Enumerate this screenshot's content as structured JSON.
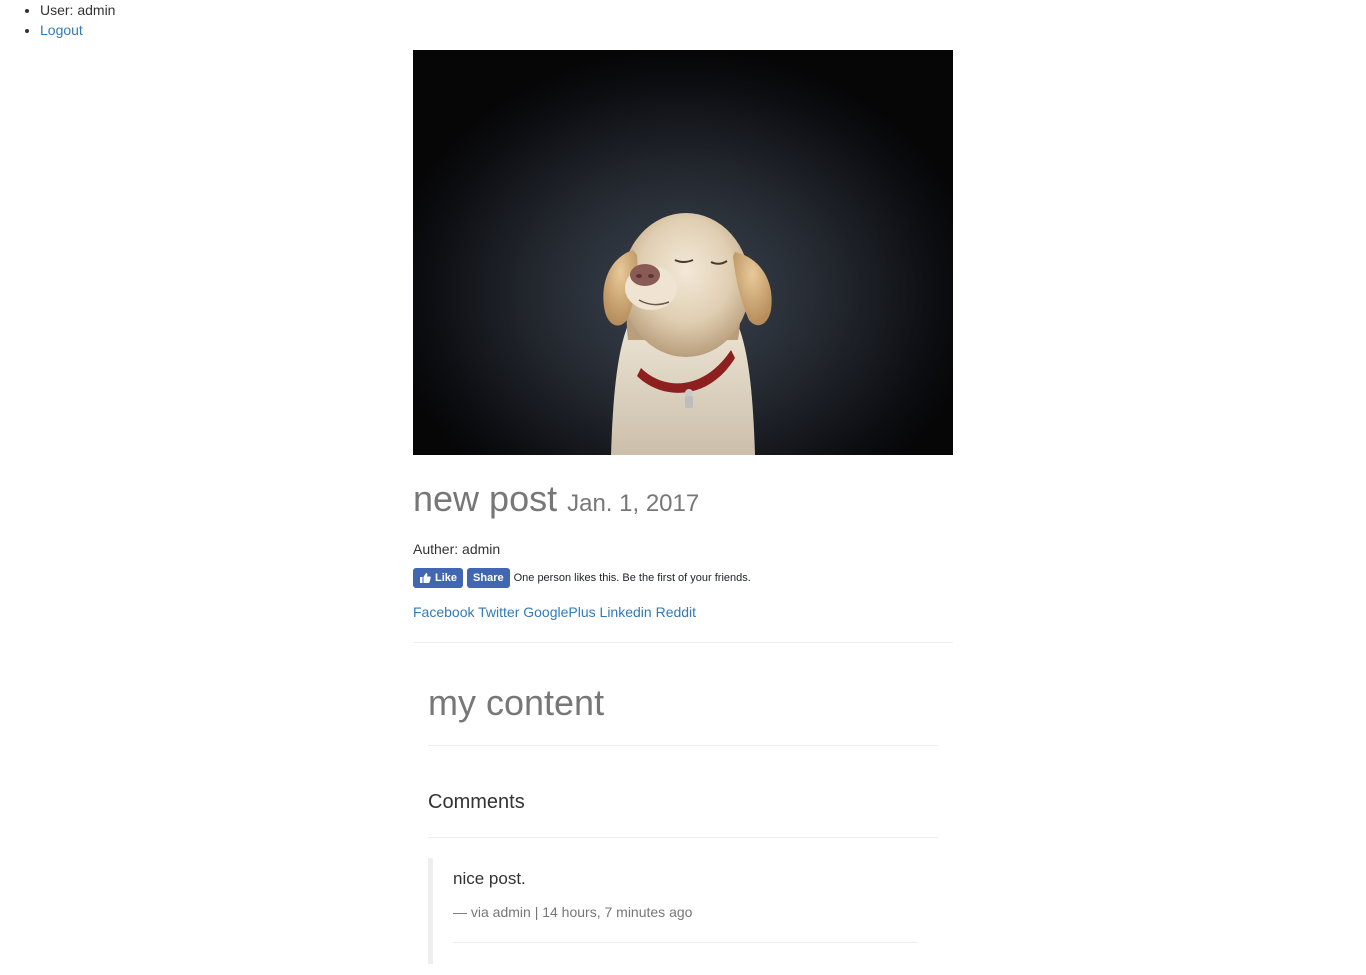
{
  "nav": {
    "user_label": "User: admin",
    "logout_label": "Logout"
  },
  "post": {
    "title": "new post",
    "date": "Jan. 1, 2017",
    "author": "Auther: admin",
    "fb": {
      "like_label": "Like",
      "share_label": "Share",
      "like_text": "One person likes this. Be the first of your friends."
    },
    "share_links": [
      "Facebook",
      "Twitter",
      "GooglePlus",
      "Linkedin",
      "Reddit"
    ],
    "content": "my content"
  },
  "comments": {
    "heading": "Comments",
    "items": [
      {
        "text": "nice post.",
        "meta": "— via admin | 14 hours, 7 minutes ago"
      }
    ]
  },
  "colors": {
    "link": "#337ab7",
    "facebook": "#4267b2",
    "muted": "#777777",
    "divider": "#eeeeee"
  }
}
